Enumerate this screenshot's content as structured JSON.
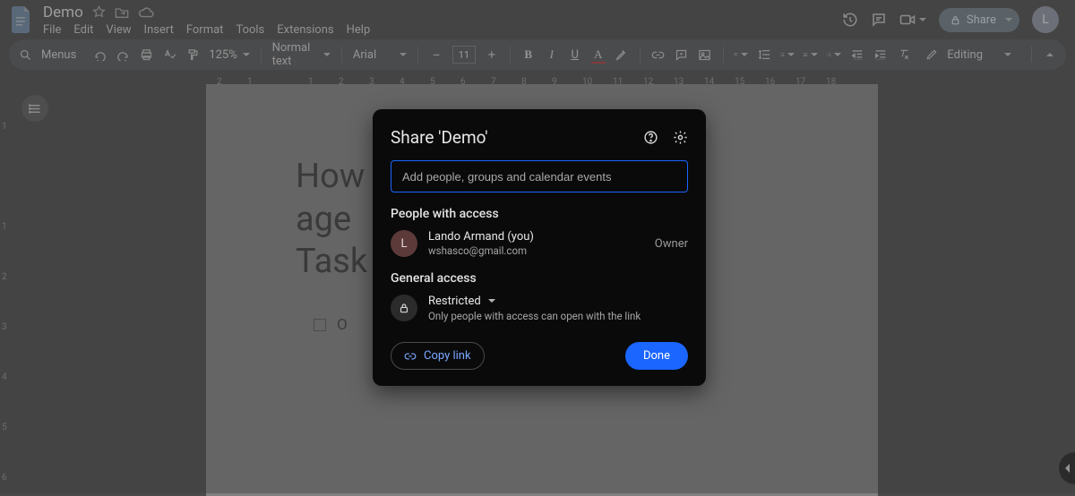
{
  "header": {
    "title": "Demo",
    "menus": [
      "File",
      "Edit",
      "View",
      "Insert",
      "Format",
      "Tools",
      "Extensions",
      "Help"
    ],
    "share_label": "Share",
    "avatar_letter": "L"
  },
  "toolbar": {
    "search_label": "Menus",
    "zoom": "125%",
    "style": "Normal text",
    "font": "Arial",
    "font_size": "11",
    "mode": "Editing"
  },
  "ruler_ticks": [
    "2",
    "1",
    "",
    "1",
    "2",
    "3",
    "4",
    "5",
    "6",
    "7",
    "8",
    "9",
    "10",
    "11",
    "12",
    "13",
    "14",
    "15",
    "16",
    "17",
    "18"
  ],
  "vruler_ticks": [
    "1",
    "",
    "1",
    "2",
    "3",
    "4",
    "5",
    "6"
  ],
  "document": {
    "heading_visible_a": "How",
    "heading_visible_b": "age",
    "heading_line2": "Task",
    "checkbox_item": "O"
  },
  "dialog": {
    "title": "Share 'Demo'",
    "input_placeholder": "Add people, groups and calendar events",
    "people_heading": "People with access",
    "person": {
      "initial": "L",
      "name": "Lando Armand (you)",
      "email": "wshasco@gmail.com",
      "role": "Owner"
    },
    "general_heading": "General access",
    "access_level": "Restricted",
    "access_desc": "Only people with access can open with the link",
    "copy_link": "Copy link",
    "done": "Done"
  }
}
